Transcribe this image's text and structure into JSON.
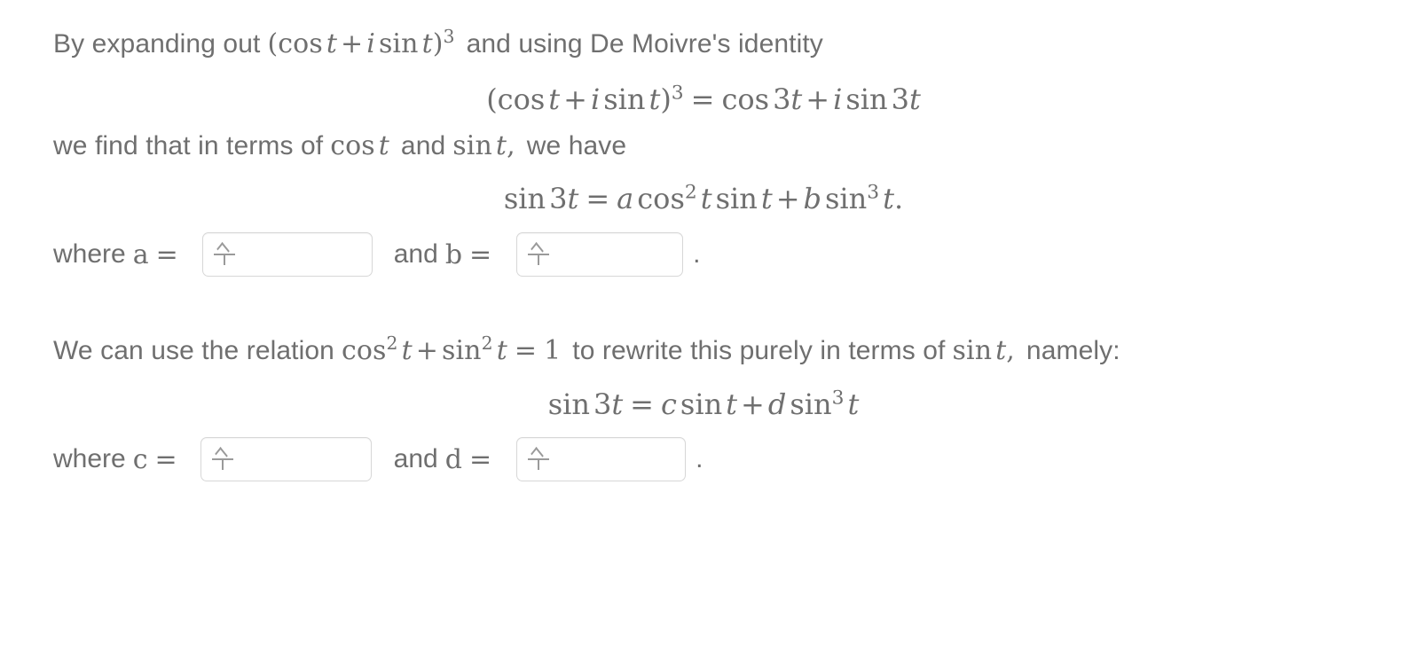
{
  "problem": {
    "intro_line": {
      "before": "By expanding out",
      "math": "(cos t + i sin t)^3",
      "after": "and using De Moivre's identity"
    },
    "identity_equation": "(cos t + i sin t)^3 = cos 3t + i sin 3t",
    "second_line": {
      "before": "we find that in terms of",
      "math_a": "cos t",
      "middle": "and",
      "math_b": "sin t,",
      "after": "we have"
    },
    "expansion_equation": "sin 3t = a cos^2 t sin t + b sin^3 t.",
    "answer_row_1": {
      "where_label": "where",
      "var_1": "a",
      "equals": "=",
      "conjunction": "and",
      "var_2": "b",
      "equals_2": "=",
      "trailing": ".",
      "input_1": {
        "value": "",
        "placeholder": "",
        "cursor_icon": "math-entry-cursor-icon"
      },
      "input_2": {
        "value": "",
        "placeholder": "",
        "cursor_icon": "math-entry-cursor-icon"
      }
    },
    "third_line": {
      "before": "We can use the relation",
      "math": "cos^2 t + sin^2 t = 1",
      "middle": "to rewrite this purely in terms of",
      "math_2": "sin t,",
      "after": "namely:"
    },
    "rewritten_equation": "sin 3t = c sin t + d sin^3 t",
    "answer_row_2": {
      "where_label": "where",
      "var_1": "c",
      "equals": "=",
      "conjunction": "and",
      "var_2": "d",
      "equals_2": "=",
      "trailing": ".",
      "input_1": {
        "value": "",
        "placeholder": "",
        "cursor_icon": "math-entry-cursor-icon"
      },
      "input_2": {
        "value": "",
        "placeholder": "",
        "cursor_icon": "math-entry-cursor-icon"
      }
    }
  },
  "colors": {
    "text": "#6f6f6f",
    "input_border": "#d7d7d7",
    "input_background": "#ffffff",
    "page_background": "#ffffff",
    "cursor_glyph": "#9a9a9a"
  }
}
